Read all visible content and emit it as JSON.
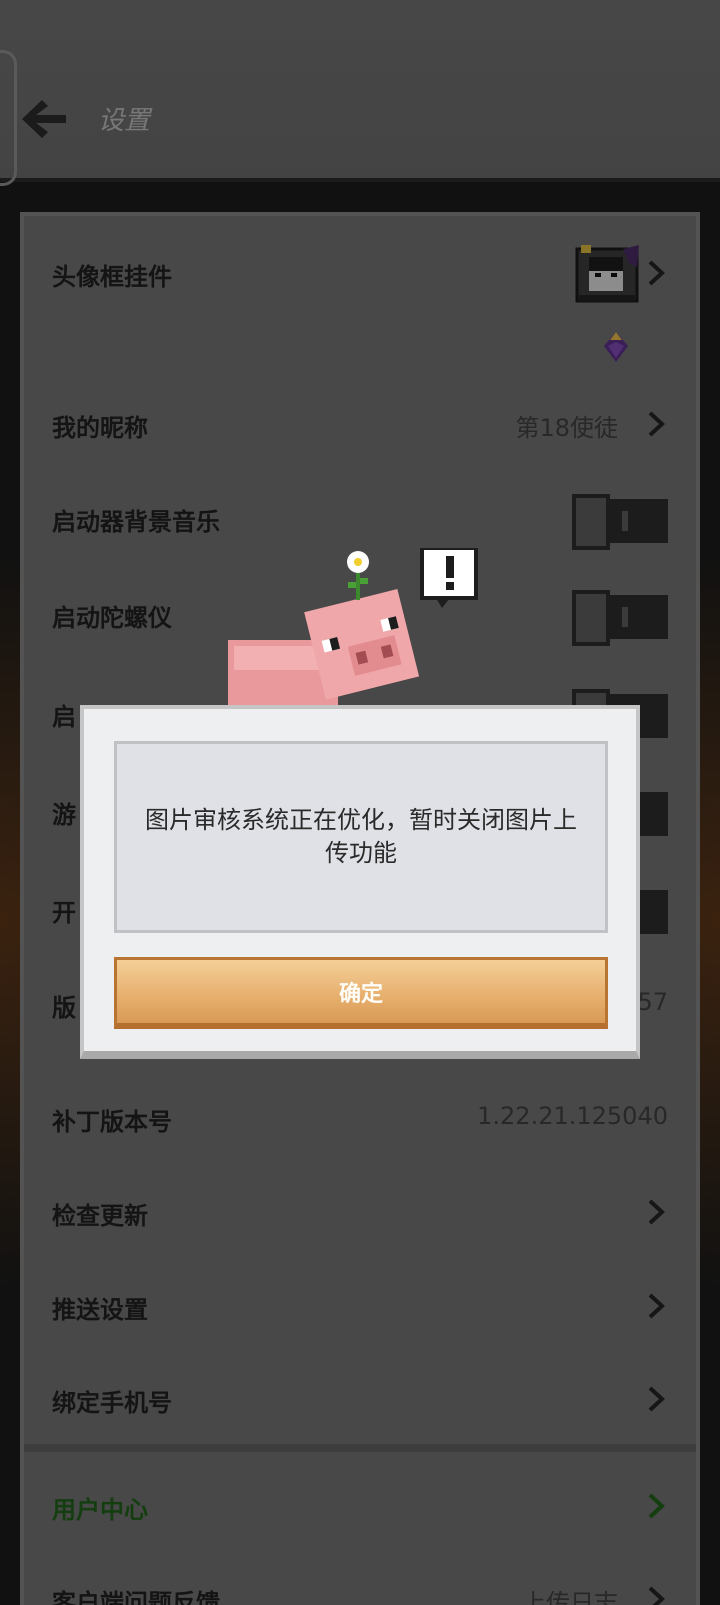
{
  "header": {
    "title": "设置"
  },
  "settings": {
    "avatar_frame": "头像框挂件",
    "nickname": {
      "label": "我的昵称",
      "value": "第18使徒"
    },
    "launcher_music": "启动器背景音乐",
    "gyroscope": "启动陀螺仪",
    "row_partial_1": "启",
    "row_partial_2": "游",
    "row_partial_3": "开",
    "version": {
      "label": "版",
      "value": "57"
    },
    "patch_version": {
      "label": "补丁版本号",
      "value": "1.22.21.125040"
    },
    "check_update": "检查更新",
    "push_settings": "推送设置",
    "bind_phone": "绑定手机号",
    "user_center": "用户中心",
    "feedback": {
      "label": "客户端问题反馈",
      "value": "上传日志"
    }
  },
  "dialog": {
    "message": "图片审核系统正在优化，暂时关闭图片上传功能",
    "confirm_label": "确定"
  },
  "colors": {
    "accent_button": "#e6ae6c",
    "user_center_text": "#1f5f19"
  }
}
